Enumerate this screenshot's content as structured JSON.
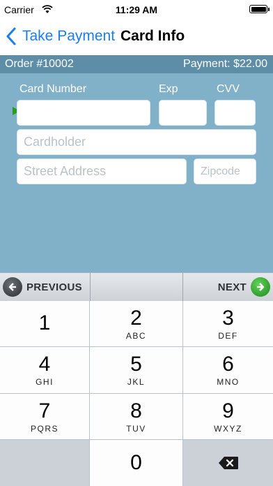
{
  "status_bar": {
    "carrier": "Carrier",
    "time": "11:29 AM"
  },
  "nav": {
    "back_label": "Take Payment",
    "title": "Card Info"
  },
  "order_bar": {
    "order": "Order #10002",
    "payment": "Payment: $22.00"
  },
  "form": {
    "card_number_label": "Card Number",
    "exp_label": "Exp",
    "cvv_label": "CVV",
    "card_number_value": "",
    "exp_value": "",
    "cvv_value": "",
    "cardholder_placeholder": "Cardholder",
    "street_placeholder": "Street Address",
    "zip_placeholder": "Zipcode"
  },
  "toolbar": {
    "previous_label": "PREVIOUS",
    "next_label": "NEXT"
  },
  "keypad": {
    "keys": [
      {
        "digit": "1",
        "letters": ""
      },
      {
        "digit": "2",
        "letters": "ABC"
      },
      {
        "digit": "3",
        "letters": "DEF"
      },
      {
        "digit": "4",
        "letters": "GHI"
      },
      {
        "digit": "5",
        "letters": "JKL"
      },
      {
        "digit": "6",
        "letters": "MNO"
      },
      {
        "digit": "7",
        "letters": "PQRS"
      },
      {
        "digit": "8",
        "letters": "TUV"
      },
      {
        "digit": "9",
        "letters": "WXYZ"
      },
      {
        "digit": "0",
        "letters": ""
      }
    ]
  },
  "colors": {
    "accent": "#1a7df0",
    "order_bar": "#5e8ea7",
    "form_background": "#81b0c9",
    "next_green": "#2aa52a"
  },
  "icons": [
    "wifi-icon",
    "battery-icon",
    "back-chevron-icon",
    "previous-arrow-icon",
    "next-arrow-icon",
    "backspace-icon",
    "field-cursor-arrow-icon"
  ]
}
